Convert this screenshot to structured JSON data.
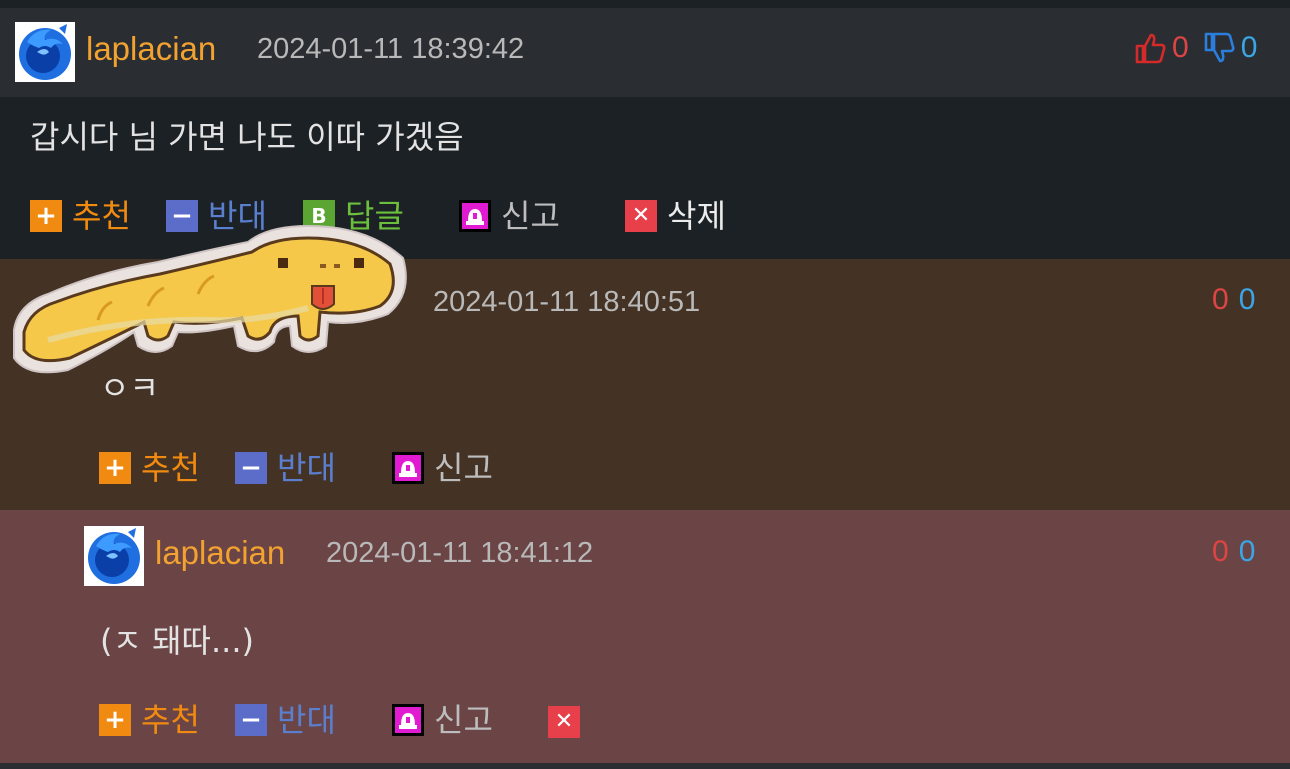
{
  "comments": [
    {
      "username": "laplacian",
      "timestamp": "2024-01-11 18:39:42",
      "up": "0",
      "down": "0",
      "text": "갑시다 님 가면 나도 이따 가겠음",
      "actions": {
        "recommend": "추천",
        "oppose": "반대",
        "reply": "답글",
        "reply_icon": "B",
        "report": "신고",
        "delete": "삭제"
      }
    },
    {
      "timestamp": "2024-01-11 18:40:51",
      "up": "0",
      "down": "0",
      "text": "ㅇㅋ",
      "actions": {
        "recommend": "추천",
        "oppose": "반대",
        "report": "신고"
      }
    },
    {
      "username": "laplacian",
      "timestamp": "2024-01-11 18:41:12",
      "up": "0",
      "down": "0",
      "text": "(ㅈ 돼따...)",
      "actions": {
        "recommend": "추천",
        "oppose": "반대",
        "report": "신고"
      }
    }
  ],
  "icons": {
    "avatar": "firefox-logo",
    "thumb_up": "thumbs-up-icon",
    "thumb_down": "thumbs-down-icon",
    "sticker": "yellow-lizard-sticker"
  },
  "colors": {
    "username": "#f2a230",
    "recommend": "#f08a10",
    "oppose": "#5b6cc9",
    "reply": "#6cbf3c",
    "report": "#e11bd2",
    "delete": "#e8404a",
    "vote_up": "#dd4444",
    "vote_down": "#3aa6e6"
  }
}
